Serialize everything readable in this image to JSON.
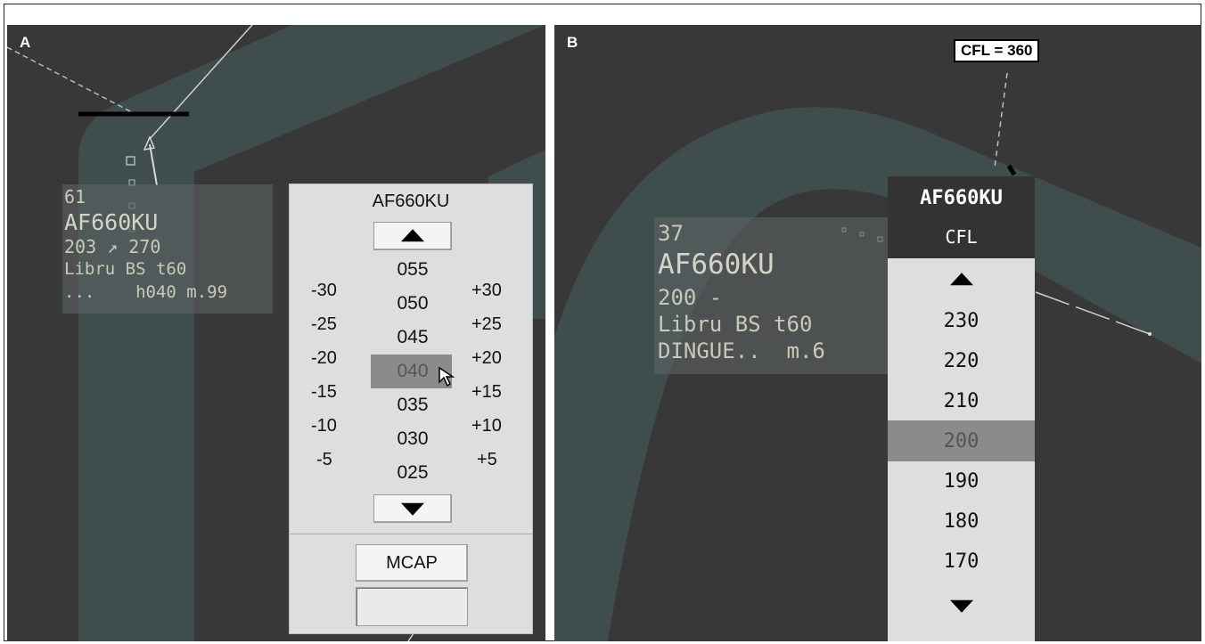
{
  "panel_a": {
    "label": "A",
    "track_label": {
      "line1": "61",
      "line2": "AF660KU",
      "line3": "203 ↗ 270",
      "line4": "Libru BS t60",
      "line5": "...    h040 m.99"
    },
    "menu": {
      "callsign": "AF660KU",
      "values": [
        "055",
        "050",
        "045",
        "040",
        "035",
        "030",
        "025"
      ],
      "selected": "040",
      "deltas_left": [
        "-30",
        "-25",
        "-20",
        "-15",
        "-10",
        "-5"
      ],
      "deltas_right": [
        "+30",
        "+25",
        "+20",
        "+15",
        "+10",
        "+5"
      ],
      "mcap_label": "MCAP",
      "mcap_value": ""
    }
  },
  "panel_b": {
    "label": "B",
    "cfl_tag": "CFL = 360",
    "track_label": {
      "line1": "37",
      "line2": "AF660KU",
      "line3": "200 -",
      "line4": "Libru BS t60",
      "line5": "DINGUE..  m.6"
    },
    "menu": {
      "callsign": "AF660KU",
      "field": "CFL",
      "values": [
        "230",
        "220",
        "210",
        "200",
        "190",
        "180",
        "170"
      ],
      "selected": "200"
    }
  },
  "colors": {
    "radar_bg": "#383838",
    "sector_band": "#3f4d4d",
    "menu_bg": "#dedede",
    "selected_bg": "#8b8b8b",
    "label_text": "#c9c9b8"
  },
  "icons": [
    "scroll-up-icon",
    "scroll-down-icon",
    "mouse-cursor-icon",
    "aircraft-track-icon"
  ]
}
